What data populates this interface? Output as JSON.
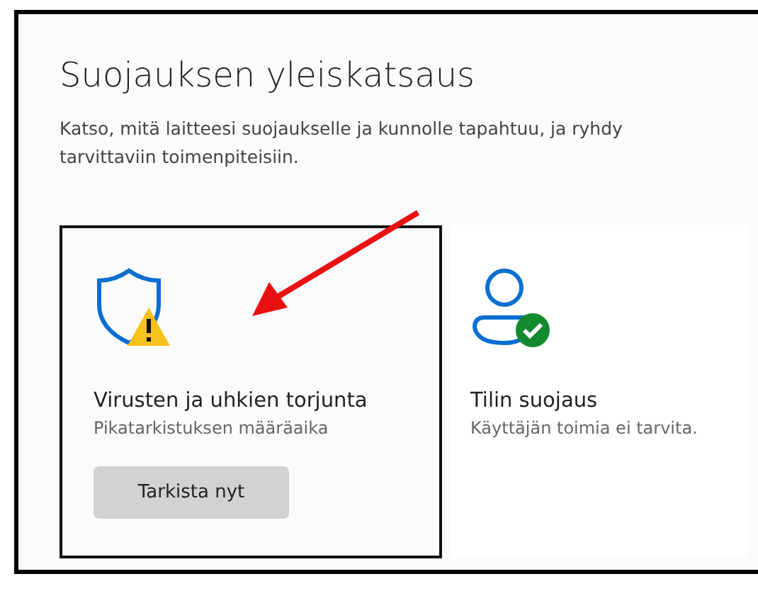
{
  "title": "Suojauksen yleiskatsaus",
  "description": "Katso, mitä laitteesi suojaukselle ja kunnolle tapahtuu, ja ryhdy tarvittaviin toimenpiteisiin.",
  "cards": [
    {
      "kind": "shield-warning",
      "title": "Virusten ja uhkien torjunta",
      "status": "Pikatarkistuksen määräaika",
      "button": "Tarkista nyt",
      "highlighted": true
    },
    {
      "kind": "person-check",
      "title": "Tilin suojaus",
      "status": "Käyttäjän toimia ei tarvita.",
      "highlighted": false
    }
  ],
  "annotation_arrow": true
}
